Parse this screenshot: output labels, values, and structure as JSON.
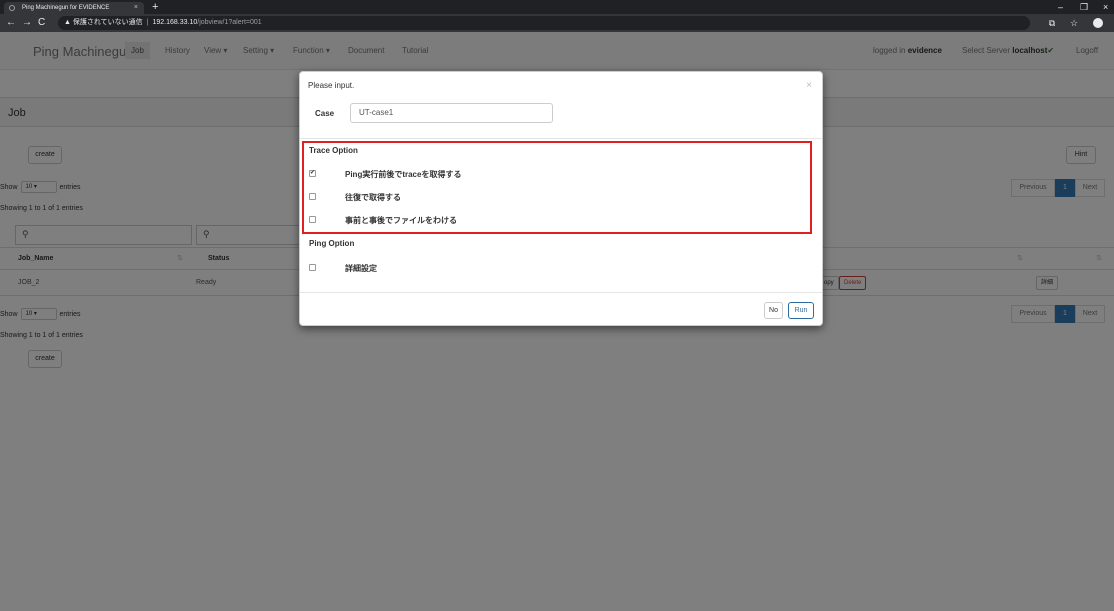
{
  "browser": {
    "tab_title": "Ping Machinegun for EVIDENCE",
    "tab_close": "×",
    "new_tab": "+",
    "security_warning": "▲ 保護されていない通信",
    "url_host": "192.168.33.10",
    "url_path": "/jobview/1?alert=001",
    "win_min": "–",
    "win_max": "❐",
    "win_close": "×"
  },
  "navbar": {
    "brand": "Ping Machinegun",
    "items": [
      "Job",
      "History",
      "View ▾",
      "Setting ▾",
      "Function ▾",
      "Document",
      "Tutorial"
    ],
    "logged_in_prefix": "logged in ",
    "logged_in_user": "evidence",
    "server_prefix": "Select Server ",
    "server_name": "localhost",
    "logoff": "Logoff"
  },
  "panel": {
    "title": "Job",
    "create": "create",
    "hint": "Hint",
    "show": "Show",
    "page_size": "10",
    "entries": "entries",
    "info": "Showing 1 to 1 of 1 entries",
    "previous": "Previous",
    "page": "1",
    "next": "Next",
    "columns": [
      "Job_Name",
      "Status"
    ],
    "rows": [
      {
        "job_name": "JOB_2",
        "status": "Ready"
      }
    ],
    "copy_partial": "opy",
    "delete": "Delete",
    "detail": "詳細"
  },
  "modal": {
    "title": "Please input.",
    "close": "×",
    "case_label": "Case",
    "case_value": "UT-case1",
    "trace_title": "Trace Option",
    "trace_options": [
      {
        "label": "Ping実行前後でtraceを取得する",
        "checked": true
      },
      {
        "label": "往復で取得する",
        "checked": false
      },
      {
        "label": "事前と事後でファイルをわける",
        "checked": false
      }
    ],
    "ping_title": "Ping Option",
    "ping_options": [
      {
        "label": "詳細設定",
        "checked": false
      }
    ],
    "no_button": "No",
    "run_button": "Run"
  },
  "colors": {
    "highlight": "#e02020",
    "primary": "#337ab7"
  }
}
